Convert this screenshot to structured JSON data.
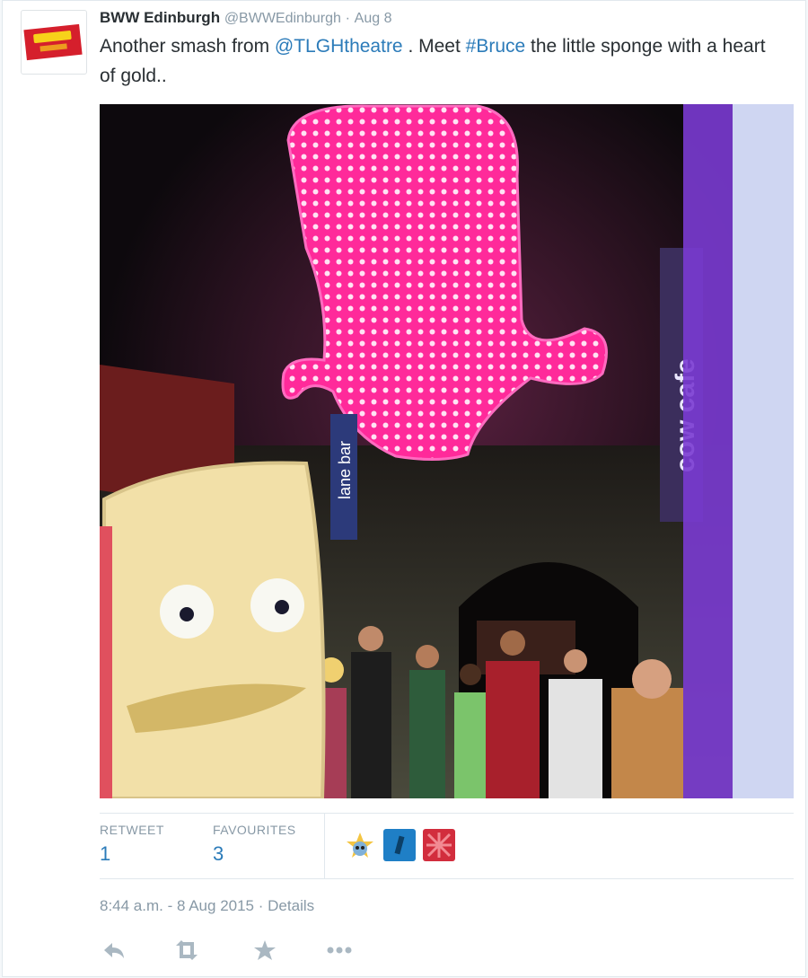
{
  "tweet": {
    "author_name": "BWW Edinburgh",
    "author_handle": "@BWWEdinburgh",
    "separator": "·",
    "date": "Aug 8",
    "text_parts": {
      "p1": "Another smash from ",
      "mention": "@TLGHtheatre",
      "p2": " . Meet ",
      "hashtag": "#Bruce",
      "p3": " the little sponge with a heart of gold.."
    },
    "photo_signs": {
      "lane_bar": "lane bar",
      "cow_cafe": "cow cafe"
    }
  },
  "stats": {
    "retweets_label": "RETWEET",
    "retweets_value": "1",
    "favourites_label": "FAVOURITES",
    "favourites_value": "3"
  },
  "footer": {
    "timestamp": "8:44 a.m. - 8 Aug 2015",
    "separator": "·",
    "details_link": "Details"
  },
  "actions": {
    "reply_icon": "reply-icon",
    "retweet_icon": "retweet-icon",
    "favorite_icon": "star-icon",
    "more_icon": "more-icon"
  },
  "colors": {
    "link": "#2b7bb9",
    "muted": "#8899a6",
    "neon_pink": "#ff3aa6"
  }
}
